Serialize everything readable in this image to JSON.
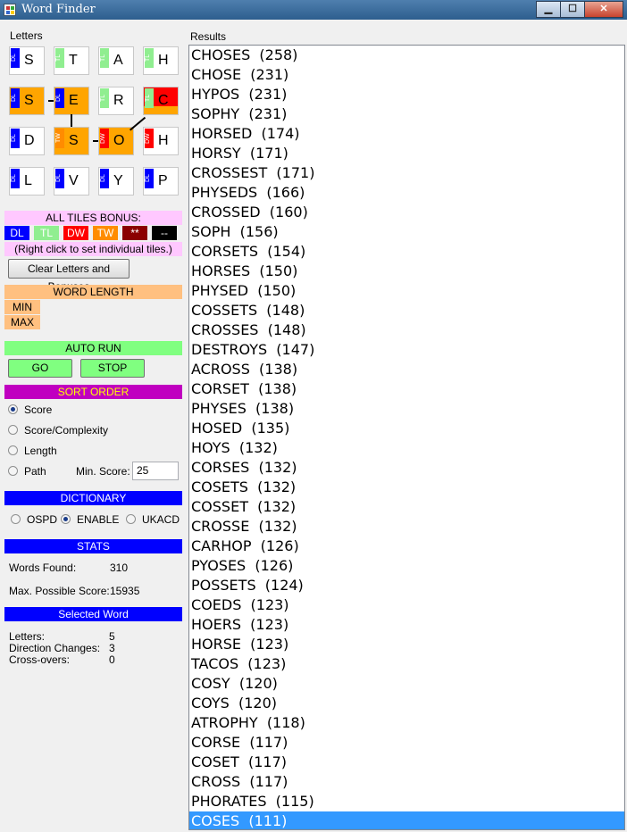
{
  "window": {
    "title": "Word Finder",
    "min": "▁",
    "max": "☐",
    "close": "✕"
  },
  "colors": {
    "dl": "#0000ff",
    "tl": "#90ee90",
    "dw": "#ff0000",
    "tw": "#ff8c00",
    "path": "#ffa500",
    "selected_tile": "#ff0000"
  },
  "letters_label": "Letters",
  "results_label": "Results",
  "tiles": [
    {
      "letter": "S",
      "badge": "DL",
      "badge_type": "dl",
      "state": "none"
    },
    {
      "letter": "T",
      "badge": "TL",
      "badge_type": "tl",
      "state": "none"
    },
    {
      "letter": "A",
      "badge": "TL",
      "badge_type": "tl",
      "state": "none"
    },
    {
      "letter": "H",
      "badge": "TL",
      "badge_type": "tl",
      "state": "none"
    },
    {
      "letter": "S",
      "badge": "DL",
      "badge_type": "dl",
      "state": "path"
    },
    {
      "letter": "E",
      "badge": "DL",
      "badge_type": "dl",
      "state": "path"
    },
    {
      "letter": "R",
      "badge": "TL",
      "badge_type": "tl",
      "state": "none"
    },
    {
      "letter": "C",
      "badge": "TL",
      "badge_type": "tl",
      "state": "start"
    },
    {
      "letter": "D",
      "badge": "DL",
      "badge_type": "dl",
      "state": "none"
    },
    {
      "letter": "S",
      "badge": "TW",
      "badge_type": "tw",
      "state": "path"
    },
    {
      "letter": "O",
      "badge": "DW",
      "badge_type": "dw",
      "state": "path"
    },
    {
      "letter": "H",
      "badge": "DW",
      "badge_type": "dw",
      "state": "none"
    },
    {
      "letter": "L",
      "badge": "DL",
      "badge_type": "dl",
      "state": "none"
    },
    {
      "letter": "V",
      "badge": "DL",
      "badge_type": "dl",
      "state": "none"
    },
    {
      "letter": "Y",
      "badge": "DL",
      "badge_type": "dl",
      "state": "none"
    },
    {
      "letter": "P",
      "badge": "DL",
      "badge_type": "dl",
      "state": "none"
    }
  ],
  "all_tiles_bonus": {
    "title": "ALL TILES BONUS:",
    "buttons": [
      "DL",
      "TL",
      "DW",
      "TW",
      "**",
      "--"
    ],
    "hint": "(Right click to set individual tiles.)"
  },
  "clear_button": "Clear Letters and Bonuses",
  "word_length": {
    "title": "WORD LENGTH",
    "min": "MIN",
    "max": "MAX"
  },
  "auto_run": {
    "title": "AUTO RUN",
    "go": "GO",
    "stop": "STOP"
  },
  "sort_order": {
    "title": "SORT ORDER",
    "options": [
      "Score",
      "Score/Complexity",
      "Length",
      "Path"
    ],
    "selected": "Score",
    "min_score_label": "Min. Score:",
    "min_score_value": "25"
  },
  "dictionary": {
    "title": "DICTIONARY",
    "options": [
      "OSPD",
      "ENABLE",
      "UKACD"
    ],
    "selected": "ENABLE"
  },
  "stats": {
    "title": "STATS",
    "words_found_label": "Words Found:",
    "words_found": "310",
    "max_score_label": "Max. Possible Score:",
    "max_score": "15935"
  },
  "selected_word": {
    "title": "Selected Word",
    "letters_label": "Letters:",
    "letters": "5",
    "direction_label": "Direction Changes:",
    "direction": "3",
    "crossovers_label": "Cross-overs:",
    "crossovers": "0"
  },
  "results": [
    "CHOSES  (258)",
    "CHOSE  (231)",
    "HYPOS  (231)",
    "SOPHY  (231)",
    "HORSED  (174)",
    "HORSY  (171)",
    "CROSSEST  (171)",
    "PHYSEDS  (166)",
    "CROSSED  (160)",
    "SOPH  (156)",
    "CORSETS  (154)",
    "HORSES  (150)",
    "PHYSED  (150)",
    "COSSETS  (148)",
    "CROSSES  (148)",
    "DESTROYS  (147)",
    "ACROSS  (138)",
    "CORSET  (138)",
    "PHYSES  (138)",
    "HOSED  (135)",
    "HOYS  (132)",
    "CORSES  (132)",
    "COSETS  (132)",
    "COSSET  (132)",
    "CROSSE  (132)",
    "CARHOP  (126)",
    "PYOSES  (126)",
    "POSSETS  (124)",
    "COEDS  (123)",
    "HOERS  (123)",
    "HORSE  (123)",
    "TACOS  (123)",
    "COSY  (120)",
    "COYS  (120)",
    "ATROPHY  (118)",
    "CORSE  (117)",
    "COSET  (117)",
    "CROSS  (117)",
    "PHORATES  (115)",
    "COSES  (111)"
  ],
  "selected_result_index": 39
}
